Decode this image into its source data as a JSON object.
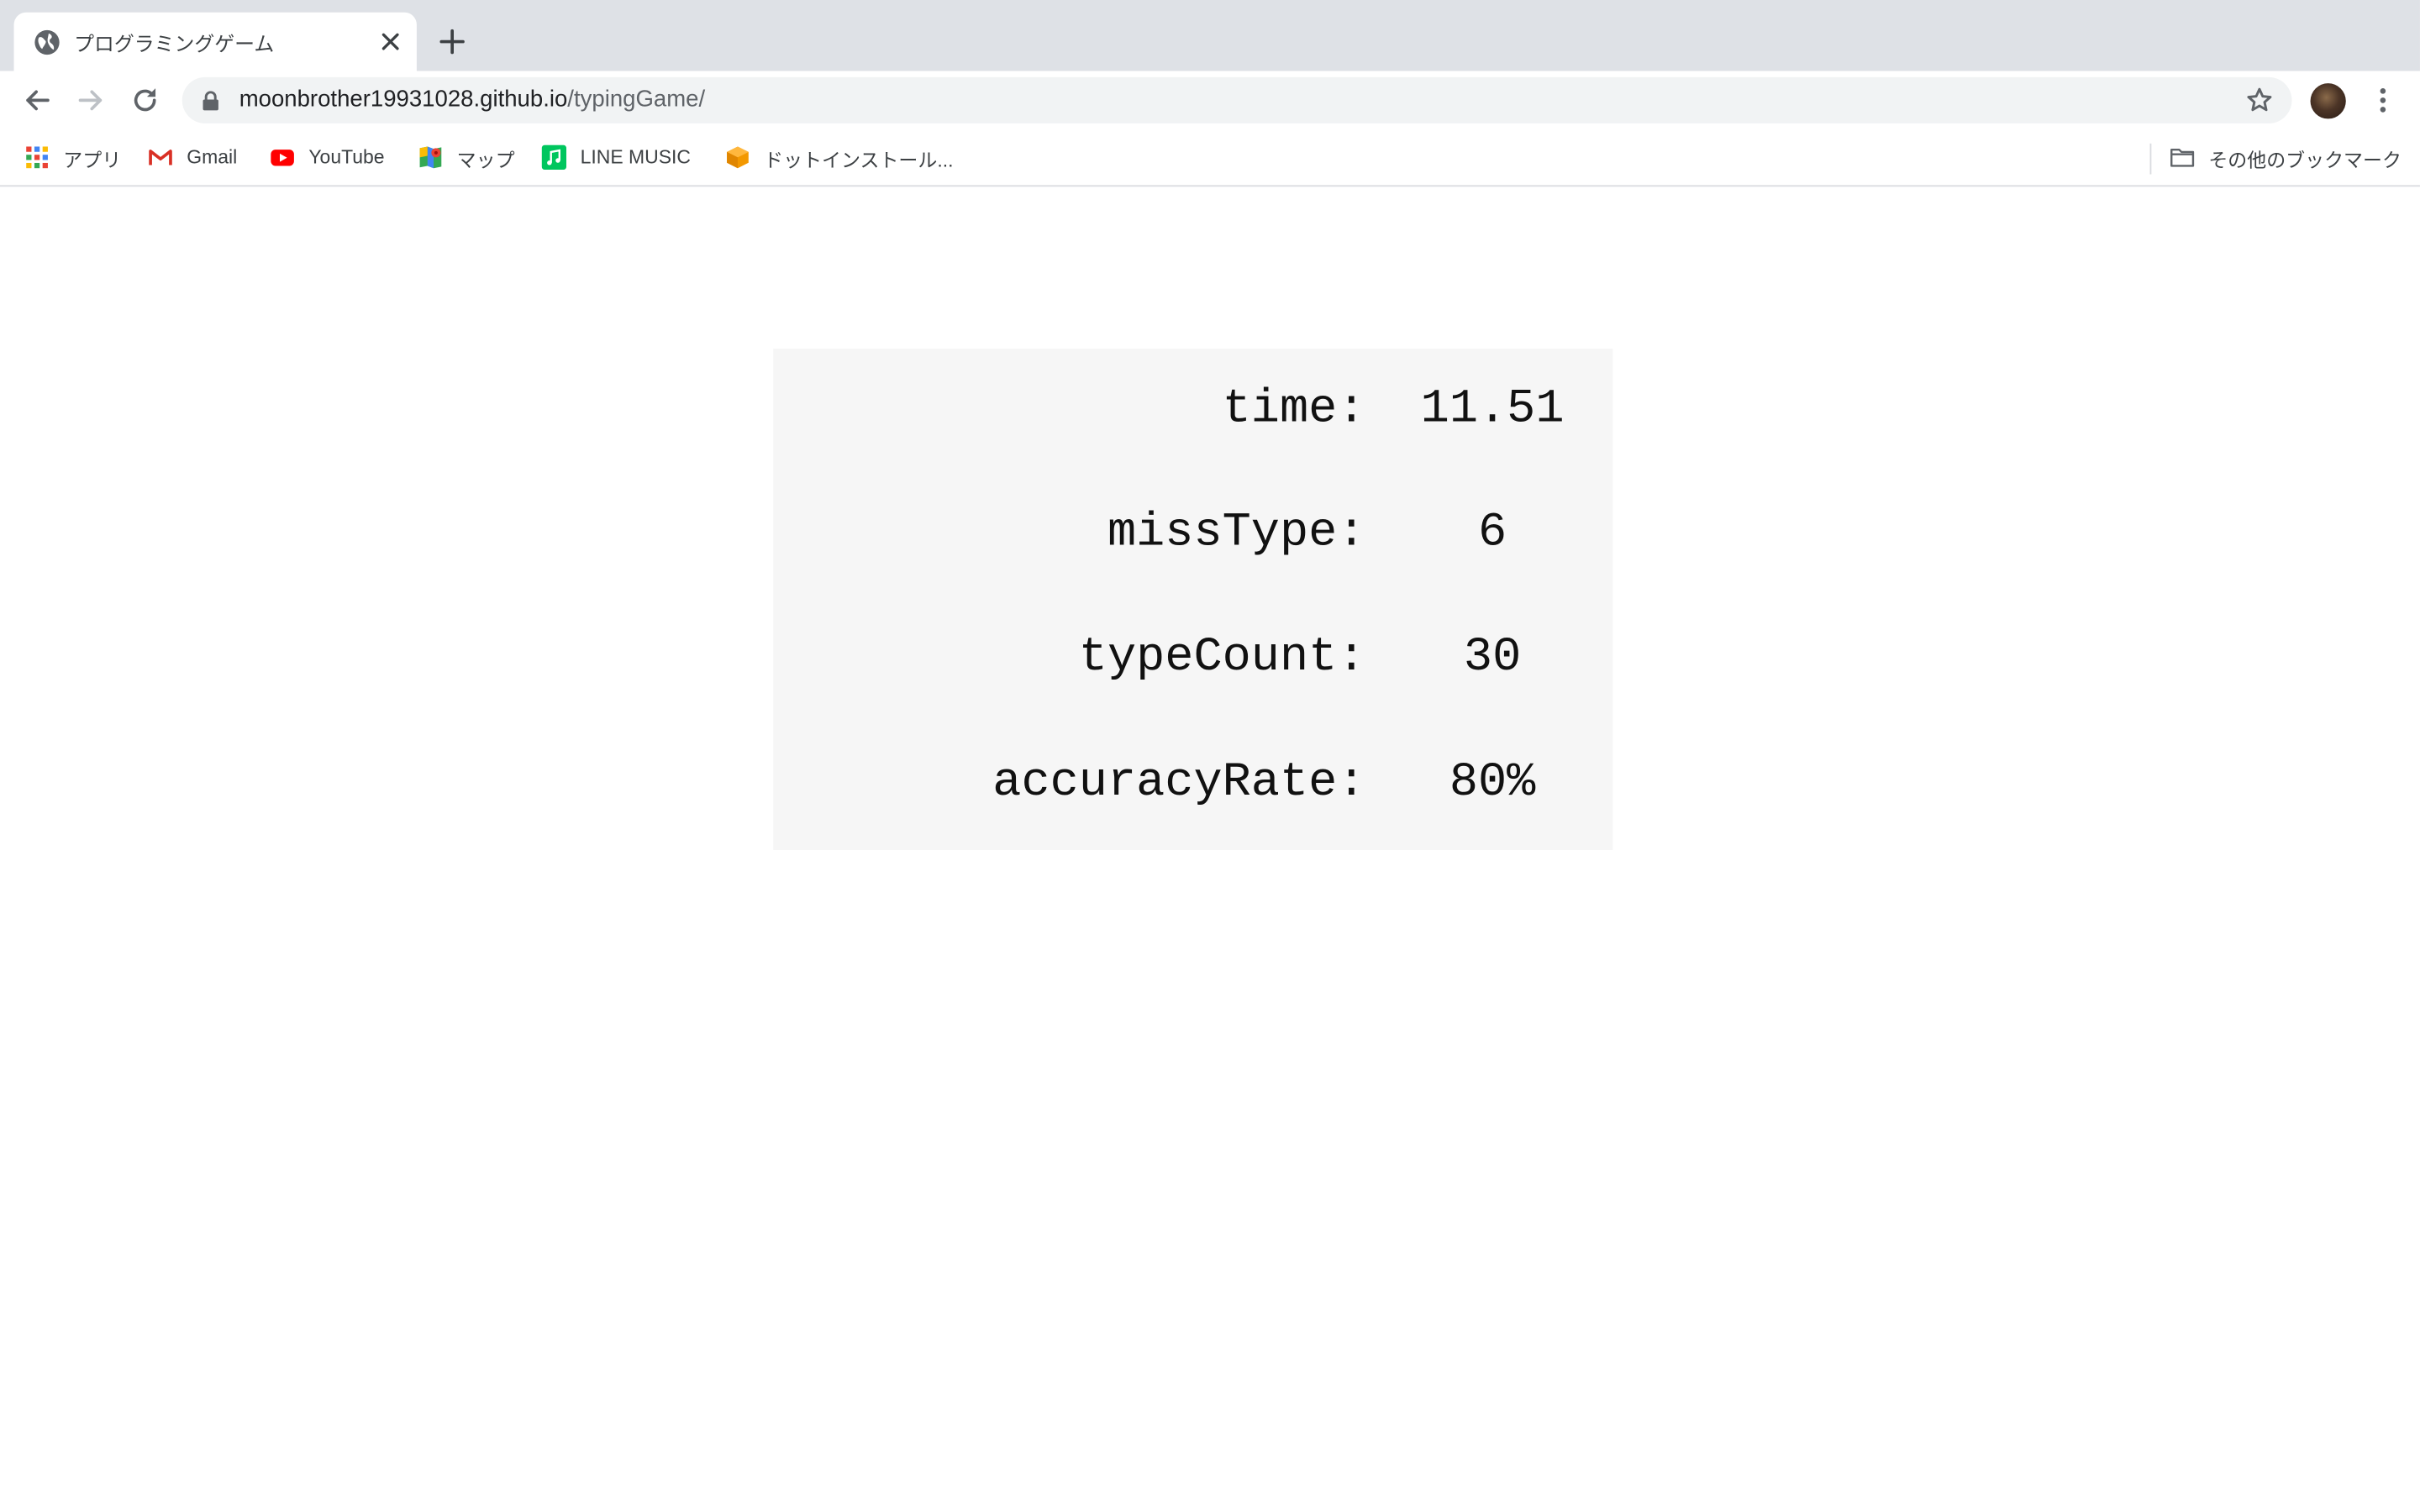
{
  "browser": {
    "tab": {
      "title": "プログラミングゲーム",
      "favicon": "globe-icon"
    },
    "address_bar": {
      "host": "moonbrother19931028.github.io",
      "path": "/typingGame/"
    },
    "bookmarks": [
      {
        "label": "アプリ",
        "icon": "apps-grid-icon"
      },
      {
        "label": "Gmail",
        "icon": "gmail-icon"
      },
      {
        "label": "YouTube",
        "icon": "youtube-icon"
      },
      {
        "label": "マップ",
        "icon": "maps-icon"
      },
      {
        "label": "LINE MUSIC",
        "icon": "line-music-icon"
      },
      {
        "label": "ドットインストール...",
        "icon": "dotinstall-icon"
      }
    ],
    "other_bookmarks": {
      "label": "その他のブックマーク",
      "icon": "folder-icon"
    }
  },
  "result": {
    "time": {
      "label": "time:",
      "value": "11.51"
    },
    "missType": {
      "label": "missType:",
      "value": "6"
    },
    "typeCount": {
      "label": "typeCount:",
      "value": "30"
    },
    "accuracyRate": {
      "label": "accuracyRate:",
      "value": "80%"
    }
  },
  "colors": {
    "tabstrip_bg": "#dee1e6",
    "omnibox_bg": "#f1f3f4",
    "panel_bg": "#f6f6f6"
  }
}
